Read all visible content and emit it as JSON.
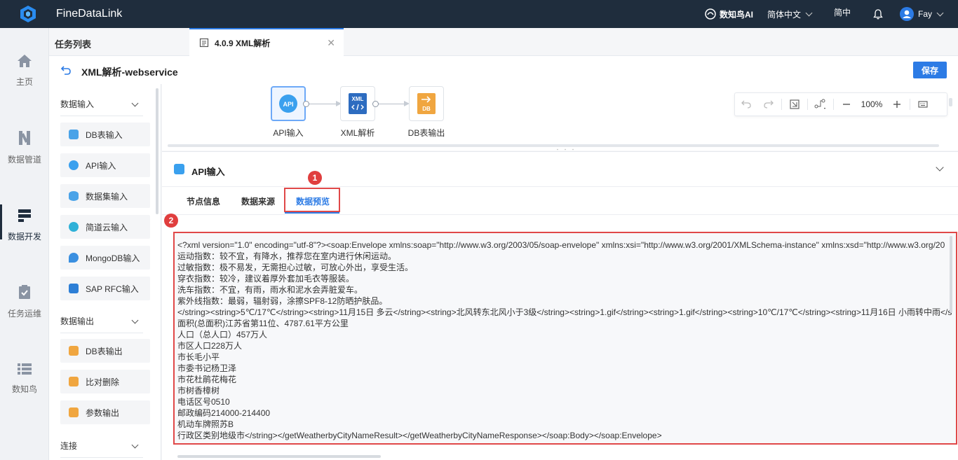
{
  "app": {
    "title": "FineDataLink"
  },
  "topbar": {
    "ai_label": "数知鸟AI",
    "language": "简体中文",
    "simplified": "简中",
    "user": "Fay"
  },
  "leftnav": {
    "items": [
      {
        "label": "主页",
        "icon": "home-icon"
      },
      {
        "label": "数据管道",
        "icon": "pipeline-icon"
      },
      {
        "label": "数据开发",
        "icon": "data-dev-icon",
        "active": true
      },
      {
        "label": "任务运维",
        "icon": "task-ops-icon"
      },
      {
        "label": "数知鸟",
        "icon": "list-icon"
      }
    ]
  },
  "tabbar": {
    "task_list": "任务列表",
    "open_tab": "4.0.9 XML解析",
    "close_symbol": "✕"
  },
  "header": {
    "title": "XML解析-webservice",
    "save": "保存"
  },
  "palette": {
    "group_input": "数据输入",
    "inputs": [
      {
        "label": "DB表输入",
        "color": "#4aa3e8"
      },
      {
        "label": "API输入",
        "color": "#3aa0ee"
      },
      {
        "label": "数据集输入",
        "color": "#4aa3e8"
      },
      {
        "label": "简道云输入",
        "color": "#2fb1d8"
      },
      {
        "label": "MongoDB输入",
        "color": "#3a8fe0"
      },
      {
        "label": "SAP RFC输入",
        "color": "#2d7fd6"
      }
    ],
    "group_output": "数据输出",
    "outputs": [
      {
        "label": "DB表输出",
        "color": "#f0a640"
      },
      {
        "label": "比对删除",
        "color": "#f0a640"
      },
      {
        "label": "参数输出",
        "color": "#f0a640"
      }
    ],
    "group_connect": "连接"
  },
  "canvas": {
    "nodes": [
      {
        "label": "API输入",
        "icon_text": "API",
        "color": "#3aa0ee"
      },
      {
        "label": "XML解析",
        "icon_text": "XML",
        "color": "#2d6cc0"
      },
      {
        "label": "DB表输出",
        "icon_text": "DB",
        "color": "#f0a640"
      }
    ],
    "toolbar": {
      "zoom": "100%"
    }
  },
  "panel": {
    "title": "API输入",
    "tabs": [
      "节点信息",
      "数据来源",
      "数据预览"
    ],
    "active_tab": "数据预览",
    "badge1": "1",
    "badge2": "2",
    "preview_lines": [
      "<?xml version=\"1.0\" encoding=\"utf-8\"?><soap:Envelope xmlns:soap=\"http://www.w3.org/2003/05/soap-envelope\" xmlns:xsi=\"http://www.w3.org/2001/XMLSchema-instance\" xmlns:xsd=\"http://www.w3.org/20",
      "运动指数：较不宜，有降水，推荐您在室内进行休闲运动。",
      "过敏指数：极不易发，无需担心过敏，可放心外出，享受生活。",
      "穿衣指数：较冷，建议着厚外套加毛衣等服装。",
      "洗车指数：不宜，有雨，雨水和泥水会弄脏爱车。",
      "紫外线指数：最弱，辐射弱，涂擦SPF8-12防晒护肤品。",
      "</string><string>5℃/17℃</string><string>11月15日 多云</string><string>北风转东北风小于3级</string><string>1.gif</string><string>1.gif</string><string>10℃/17℃</string><string>11月16日 小雨转中雨</s",
      "面积(总面积)江苏省第11位、4787.61平方公里",
      "人口（总人口）457万人",
      "市区人口228万人",
      "市长毛小平",
      "市委书记杨卫泽",
      "市花杜鹃花梅花",
      "市树香樟树",
      "电话区号0510",
      "邮政编码214000-214400",
      "机动车牌照苏B",
      "行政区类别地级市</string></getWeatherbyCityNameResult></getWeatherbyCityNameResponse></soap:Body></soap:Envelope>"
    ]
  }
}
